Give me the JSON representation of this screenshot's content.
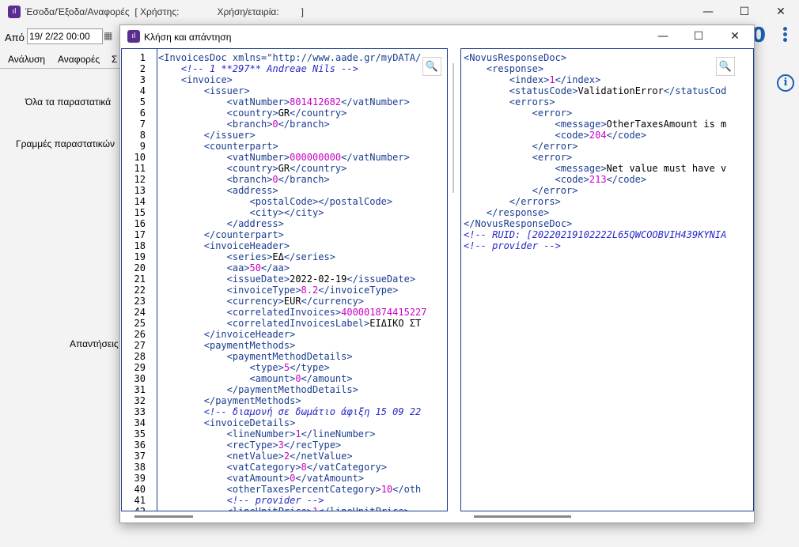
{
  "main_window": {
    "title_part1": "Έσοδα/Έξοδα/Αναφορές",
    "title_user_label": "[ Χρήστης:",
    "title_company_label": "Χρήση/εταιρία:",
    "title_close": "]",
    "from_label": "Από",
    "date_value": "19/  2/22 00:00",
    "tabs": [
      "Ανάλυση",
      "Αναφορές",
      "Σ"
    ],
    "label_all_documents": "Όλα τα παραστατικά",
    "label_document_lines": "Γραμμές παραστατικών",
    "label_responses": "Απαντήσεις",
    "big_value": "0"
  },
  "dialog": {
    "title": "Κλήση και απάντηση"
  },
  "request_lines": [
    [
      [
        "t",
        "<InvoicesDoc xmlns=\"http://www.aade.gr/myDATA/"
      ]
    ],
    [
      [
        "c",
        "<!-- 1 **297** Andreae Nils -->"
      ]
    ],
    [
      [
        "t",
        "<invoice>"
      ]
    ],
    [
      [
        "t",
        "<issuer>"
      ]
    ],
    [
      [
        "t",
        "<vatNumber>"
      ],
      [
        "v",
        "801412682"
      ],
      [
        "t",
        "</vatNumber>"
      ]
    ],
    [
      [
        "t",
        "<country>"
      ],
      [
        "x",
        "GR"
      ],
      [
        "t",
        "</country>"
      ]
    ],
    [
      [
        "t",
        "<branch>"
      ],
      [
        "v",
        "0"
      ],
      [
        "t",
        "</branch>"
      ]
    ],
    [
      [
        "t",
        "</issuer>"
      ]
    ],
    [
      [
        "t",
        "<counterpart>"
      ]
    ],
    [
      [
        "t",
        "<vatNumber>"
      ],
      [
        "v",
        "000000000"
      ],
      [
        "t",
        "</vatNumber>"
      ]
    ],
    [
      [
        "t",
        "<country>"
      ],
      [
        "x",
        "GR"
      ],
      [
        "t",
        "</country>"
      ]
    ],
    [
      [
        "t",
        "<branch>"
      ],
      [
        "v",
        "0"
      ],
      [
        "t",
        "</branch>"
      ]
    ],
    [
      [
        "t",
        "<address>"
      ]
    ],
    [
      [
        "t",
        "<postalCode></postalCode>"
      ]
    ],
    [
      [
        "t",
        "<city></city>"
      ]
    ],
    [
      [
        "t",
        "</address>"
      ]
    ],
    [
      [
        "t",
        "</counterpart>"
      ]
    ],
    [
      [
        "t",
        "<invoiceHeader>"
      ]
    ],
    [
      [
        "t",
        "<series>"
      ],
      [
        "x",
        "ΕΔ"
      ],
      [
        "t",
        "</series>"
      ]
    ],
    [
      [
        "t",
        "<aa>"
      ],
      [
        "v",
        "50"
      ],
      [
        "t",
        "</aa>"
      ]
    ],
    [
      [
        "t",
        "<issueDate>"
      ],
      [
        "x",
        "2022-02-19"
      ],
      [
        "t",
        "</issueDate>"
      ]
    ],
    [
      [
        "t",
        "<invoiceType>"
      ],
      [
        "v",
        "8.2"
      ],
      [
        "t",
        "</invoiceType>"
      ]
    ],
    [
      [
        "t",
        "<currency>"
      ],
      [
        "x",
        "EUR"
      ],
      [
        "t",
        "</currency>"
      ]
    ],
    [
      [
        "t",
        "<correlatedInvoices>"
      ],
      [
        "v",
        "400001874415227"
      ]
    ],
    [
      [
        "t",
        "<correlatedInvoicesLabel>"
      ],
      [
        "x",
        "ΕΙΔΙΚΟ ΣΤ"
      ]
    ],
    [
      [
        "t",
        "</invoiceHeader>"
      ]
    ],
    [
      [
        "t",
        "<paymentMethods>"
      ]
    ],
    [
      [
        "t",
        "<paymentMethodDetails>"
      ]
    ],
    [
      [
        "t",
        "<type>"
      ],
      [
        "v",
        "5"
      ],
      [
        "t",
        "</type>"
      ]
    ],
    [
      [
        "t",
        "<amount>"
      ],
      [
        "v",
        "0"
      ],
      [
        "t",
        "</amount>"
      ]
    ],
    [
      [
        "t",
        "</paymentMethodDetails>"
      ]
    ],
    [
      [
        "t",
        "</paymentMethods>"
      ]
    ],
    [
      [
        "c",
        "<!-- διαμονή σε δωμάτιο άφιξη 15 09 22"
      ]
    ],
    [
      [
        "t",
        "<invoiceDetails>"
      ]
    ],
    [
      [
        "t",
        "<lineNumber>"
      ],
      [
        "v",
        "1"
      ],
      [
        "t",
        "</lineNumber>"
      ]
    ],
    [
      [
        "t",
        "<recType>"
      ],
      [
        "v",
        "3"
      ],
      [
        "t",
        "</recType>"
      ]
    ],
    [
      [
        "t",
        "<netValue>"
      ],
      [
        "v",
        "2"
      ],
      [
        "t",
        "</netValue>"
      ]
    ],
    [
      [
        "t",
        "<vatCategory>"
      ],
      [
        "v",
        "8"
      ],
      [
        "t",
        "</vatCategory>"
      ]
    ],
    [
      [
        "t",
        "<vatAmount>"
      ],
      [
        "v",
        "0"
      ],
      [
        "t",
        "</vatAmount>"
      ]
    ],
    [
      [
        "t",
        "<otherTaxesPercentCategory>"
      ],
      [
        "v",
        "10"
      ],
      [
        "t",
        "</oth"
      ]
    ],
    [
      [
        "c",
        "<!-- provider -->"
      ]
    ],
    [
      [
        "t",
        "<lineUnitPrice>"
      ],
      [
        "v",
        "1"
      ],
      [
        "t",
        "</lineUnitPrice>"
      ]
    ]
  ],
  "response_lines": [
    [
      [
        "t",
        "<NovusResponseDoc>"
      ]
    ],
    [
      [
        "t",
        "<response>"
      ]
    ],
    [
      [
        "t",
        "<index>"
      ],
      [
        "v",
        "1"
      ],
      [
        "t",
        "</index>"
      ]
    ],
    [
      [
        "t",
        "<statusCode>"
      ],
      [
        "x",
        "ValidationError"
      ],
      [
        "t",
        "</statusCod"
      ]
    ],
    [
      [
        "t",
        "<errors>"
      ]
    ],
    [
      [
        "t",
        "<error>"
      ]
    ],
    [
      [
        "t",
        "<message>"
      ],
      [
        "x",
        "OtherTaxesAmount is m"
      ]
    ],
    [
      [
        "t",
        "<code>"
      ],
      [
        "v",
        "204"
      ],
      [
        "t",
        "</code>"
      ]
    ],
    [
      [
        "t",
        "</error>"
      ]
    ],
    [
      [
        "t",
        "<error>"
      ]
    ],
    [
      [
        "t",
        "<message>"
      ],
      [
        "x",
        "Net value must have v"
      ]
    ],
    [
      [
        "t",
        "<code>"
      ],
      [
        "v",
        "213"
      ],
      [
        "t",
        "</code>"
      ]
    ],
    [
      [
        "t",
        "</error>"
      ]
    ],
    [
      [
        "t",
        "</errors>"
      ]
    ],
    [
      [
        "t",
        "</response>"
      ]
    ],
    [
      [
        "t",
        "</NovusResponseDoc>"
      ]
    ],
    [
      [
        "c",
        "<!-- RUID: [20220219102222L65QWCOOBVIH439KYNIA"
      ]
    ],
    [
      [
        "c",
        "<!-- provider -->"
      ]
    ]
  ],
  "icons": {
    "app": "chart-icon",
    "zoom": "magnifier-icon",
    "calendar": "calendar-icon",
    "info": "info-icon",
    "menu": "kebab-menu-icon"
  }
}
